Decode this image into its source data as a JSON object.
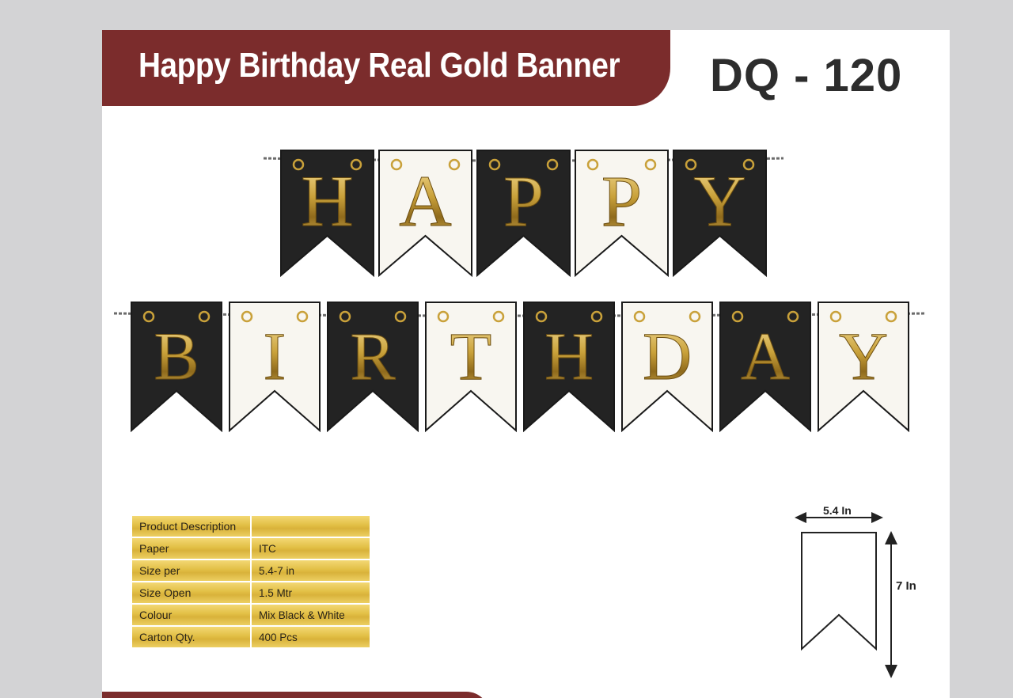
{
  "header": {
    "title": "Happy Birthday Real Gold Banner",
    "code": "DQ - 120"
  },
  "banner": {
    "row1": [
      "H",
      "A",
      "P",
      "P",
      "Y"
    ],
    "row2": [
      "B",
      "I",
      "R",
      "T",
      "H",
      "D",
      "A",
      "Y"
    ],
    "flag_colors": [
      "#232323",
      "#f8f6f0"
    ],
    "letter_color": "#c9a13a"
  },
  "specs": {
    "heading": "Product Description",
    "rows": [
      {
        "label": "Paper",
        "value": "ITC"
      },
      {
        "label": "Size per",
        "value": "5.4-7 in"
      },
      {
        "label": "Size Open",
        "value": "1.5 Mtr"
      },
      {
        "label": "Colour",
        "value": "Mix Black & White"
      },
      {
        "label": "Carton Qty.",
        "value": "400 Pcs"
      }
    ]
  },
  "dimension": {
    "width_label": "5.4 In",
    "height_label": "7  In"
  }
}
